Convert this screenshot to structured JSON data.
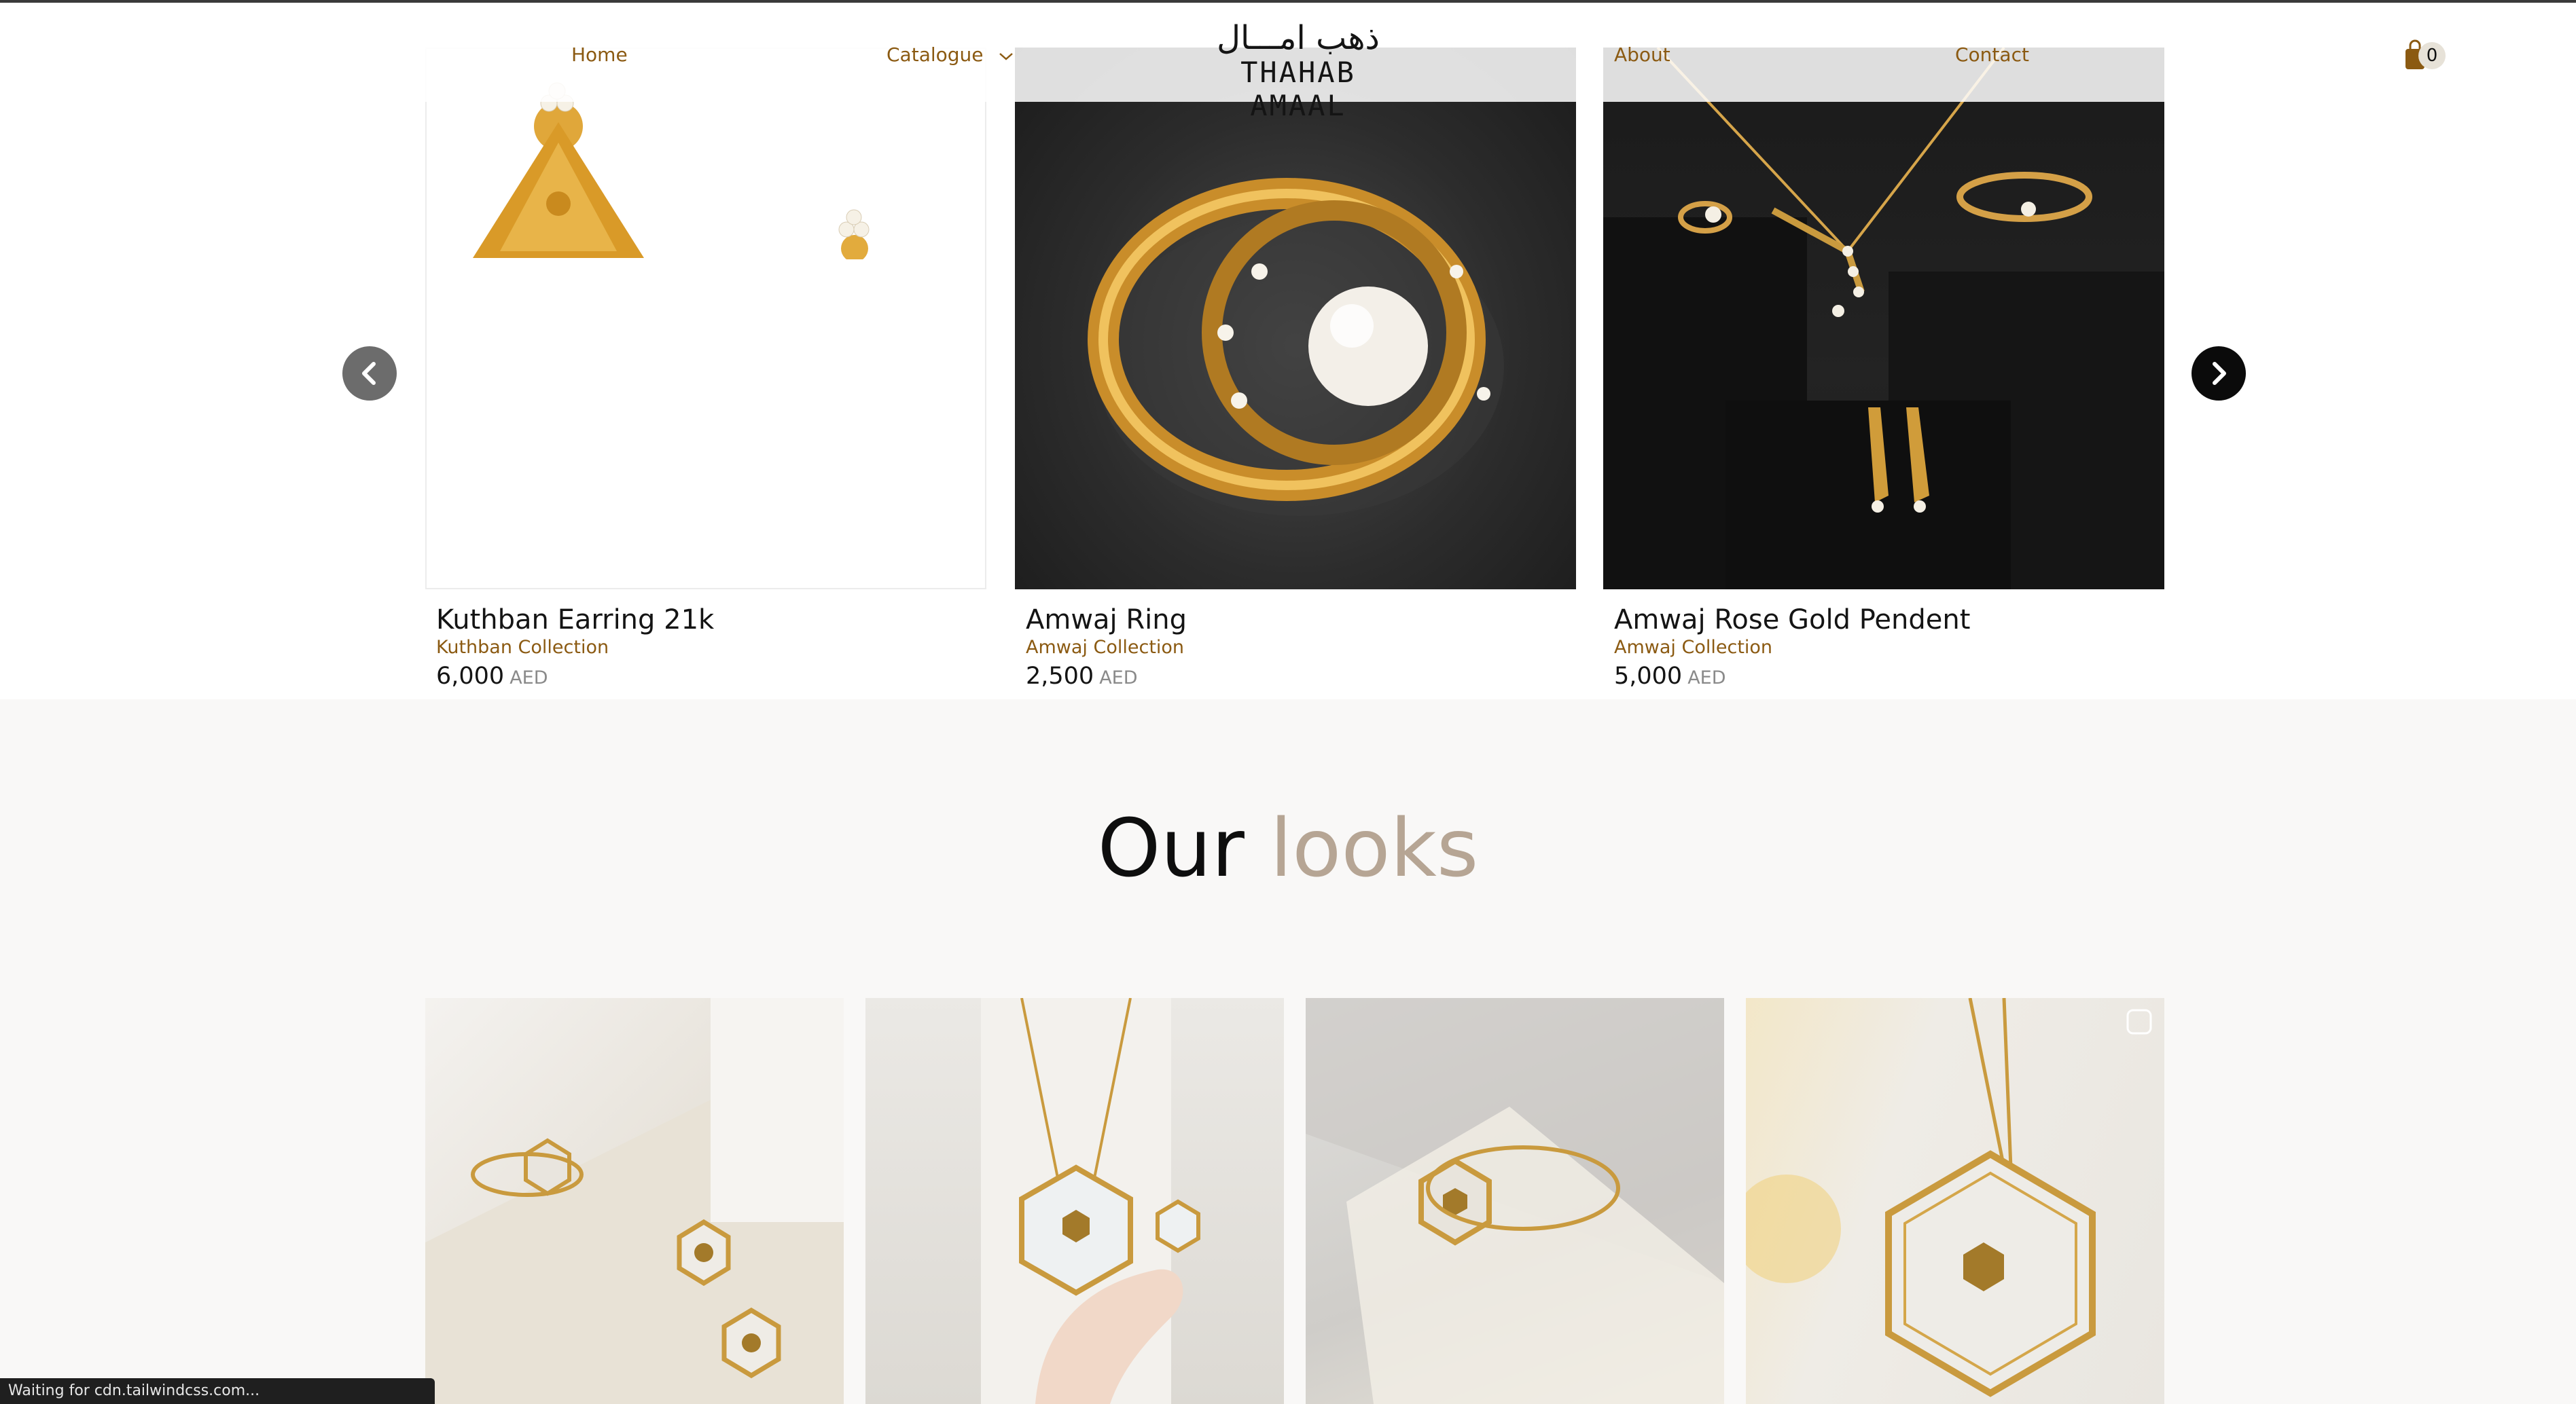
{
  "nav": {
    "home": "Home",
    "catalogue": "Catalogue",
    "about": "About",
    "contact": "Contact"
  },
  "logo": {
    "arabic": "ذهب امـــال",
    "english": "THAHAB AMAAL"
  },
  "cart": {
    "count": "0"
  },
  "products": [
    {
      "name": "Kuthban Earring 21k",
      "collection": "Kuthban Collection",
      "price": "6,000",
      "currency": "AED",
      "image_icon": "earring-image"
    },
    {
      "name": "Amwaj Ring",
      "collection": "Amwaj Collection",
      "price": "2,500",
      "currency": "AED",
      "image_icon": "ring-image"
    },
    {
      "name": "Amwaj Rose Gold Pendent",
      "collection": "Amwaj Collection",
      "price": "5,000",
      "currency": "AED",
      "image_icon": "pendant-image"
    }
  ],
  "looks": {
    "title_part1": "Our",
    "title_part2": "looks",
    "items": [
      "look-set-image",
      "look-necklace-hand-image",
      "look-ring-image",
      "look-pendant-image"
    ]
  },
  "colors": {
    "accent_gold": "#8b5a12",
    "looks_muted": "#b6a594",
    "arrow_next": "#0b0b0b",
    "arrow_prev": "#6c6c6c"
  },
  "status_bar": {
    "text": "Waiting for cdn.tailwindcss.com..."
  }
}
